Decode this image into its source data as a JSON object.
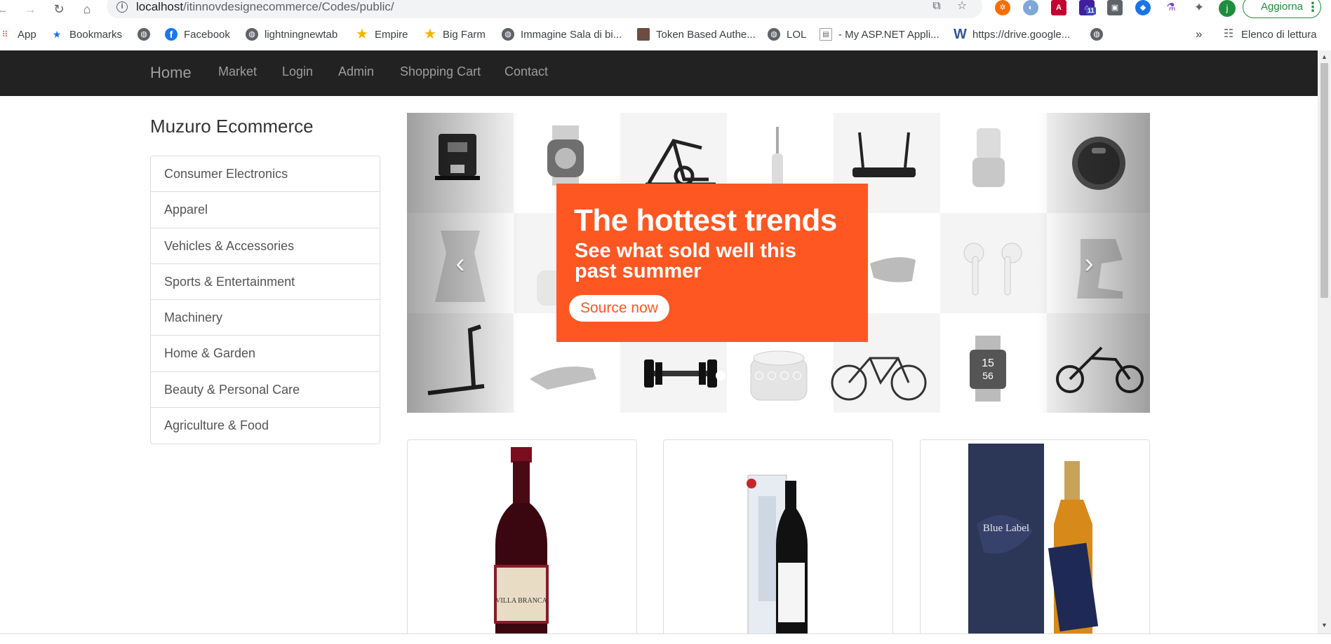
{
  "browser": {
    "url_host": "localhost",
    "url_path": "/itinnovdesignecommerce/Codes/public/",
    "update_label": "Aggiorna",
    "profile_initial": "j",
    "extension_badge": "11"
  },
  "bookmarks": {
    "items": [
      {
        "label": "App",
        "icon": "apps-grid-icon"
      },
      {
        "label": "Bookmarks",
        "icon": "star-icon"
      },
      {
        "label": "",
        "icon": "globe-icon"
      },
      {
        "label": "Facebook",
        "icon": "facebook-icon"
      },
      {
        "label": "lightningnewtab",
        "icon": "globe-icon"
      },
      {
        "label": "Empire",
        "icon": "star-icon"
      },
      {
        "label": "Big Farm",
        "icon": "star-icon"
      },
      {
        "label": "Immagine Sala di bi...",
        "icon": "globe-icon"
      },
      {
        "label": "Token Based Authe...",
        "icon": "image-icon"
      },
      {
        "label": "LOL",
        "icon": "globe-icon"
      },
      {
        "label": "- My ASP.NET Appli...",
        "icon": "page-icon"
      },
      {
        "label": "https://drive.google...",
        "icon": "word-icon"
      },
      {
        "label": "",
        "icon": "globe-icon"
      }
    ],
    "overflow_label": "»",
    "reading_list_label": "Elenco di lettura"
  },
  "navbar": {
    "brand": "Home",
    "links": [
      "Market",
      "Login",
      "Admin",
      "Shopping Cart",
      "Contact"
    ]
  },
  "sidebar": {
    "title": "Muzuro Ecommerce",
    "categories": [
      "Consumer Electronics",
      "Apparel",
      "Vehicles & Accessories",
      "Sports & Entertainment",
      "Machinery",
      "Home & Garden",
      "Beauty & Personal Care",
      "Agriculture & Food"
    ]
  },
  "carousel": {
    "headline": "The hottest trends",
    "subheadline": "See what sold well this past summer",
    "cta": "Source now",
    "prev_icon": "‹",
    "next_icon": "›",
    "slide_count": 7,
    "active_slide": 0,
    "watch_time_hour": "15",
    "watch_time_minute": "56",
    "colors": {
      "promo": "#ff5722"
    }
  },
  "products": [
    {
      "name": "Villa Branca red wine",
      "label": "VILLA BRANCA"
    },
    {
      "name": "Japanese sake bottle",
      "label": ""
    },
    {
      "name": "Johnnie Walker Blue Label",
      "label": "Blue Label"
    }
  ],
  "colors": {
    "navbar_bg": "#222222",
    "navbar_text": "#9d9d9d",
    "accent_green": "#1e8e3e"
  }
}
